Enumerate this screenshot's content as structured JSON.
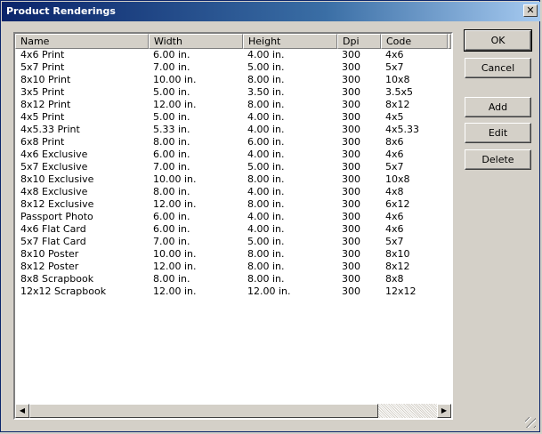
{
  "window": {
    "title": "Product Renderings",
    "close_glyph": "✕"
  },
  "table": {
    "columns": [
      "Name",
      "Width",
      "Height",
      "Dpi",
      "Code"
    ],
    "rows": [
      [
        "4x6 Print",
        "6.00 in.",
        "4.00 in.",
        "300",
        "4x6"
      ],
      [
        "5x7 Print",
        "7.00 in.",
        "5.00 in.",
        "300",
        "5x7"
      ],
      [
        "8x10 Print",
        "10.00 in.",
        "8.00 in.",
        "300",
        "10x8"
      ],
      [
        "3x5 Print",
        "5.00 in.",
        "3.50 in.",
        "300",
        "3.5x5"
      ],
      [
        "8x12 Print",
        "12.00 in.",
        "8.00 in.",
        "300",
        "8x12"
      ],
      [
        "4x5 Print",
        "5.00 in.",
        "4.00 in.",
        "300",
        "4x5"
      ],
      [
        "4x5.33 Print",
        "5.33 in.",
        "4.00 in.",
        "300",
        "4x5.33"
      ],
      [
        "6x8 Print",
        "8.00 in.",
        "6.00 in.",
        "300",
        "8x6"
      ],
      [
        "4x6 Exclusive",
        "6.00 in.",
        "4.00 in.",
        "300",
        "4x6"
      ],
      [
        "5x7 Exclusive",
        "7.00 in.",
        "5.00 in.",
        "300",
        "5x7"
      ],
      [
        "8x10 Exclusive",
        "10.00 in.",
        "8.00 in.",
        "300",
        "10x8"
      ],
      [
        "4x8 Exclusive",
        "8.00 in.",
        "4.00 in.",
        "300",
        "4x8"
      ],
      [
        "8x12 Exclusive",
        "12.00 in.",
        "8.00 in.",
        "300",
        "6x12"
      ],
      [
        "Passport Photo",
        "6.00 in.",
        "4.00 in.",
        "300",
        "4x6"
      ],
      [
        "4x6 Flat Card",
        "6.00 in.",
        "4.00 in.",
        "300",
        "4x6"
      ],
      [
        "5x7 Flat Card",
        "7.00 in.",
        "5.00 in.",
        "300",
        "5x7"
      ],
      [
        "8x10 Poster",
        "10.00 in.",
        "8.00 in.",
        "300",
        "8x10"
      ],
      [
        "8x12 Poster",
        "12.00 in.",
        "8.00 in.",
        "300",
        "8x12"
      ],
      [
        "8x8 Scrapbook",
        "8.00 in.",
        "8.00 in.",
        "300",
        "8x8"
      ],
      [
        "12x12 Scrapbook",
        "12.00 in.",
        "12.00 in.",
        "300",
        "12x12"
      ]
    ]
  },
  "scrollbar": {
    "left_arrow": "◀",
    "right_arrow": "▶"
  },
  "buttons": {
    "ok": "OK",
    "cancel": "Cancel",
    "add": "Add",
    "edit": "Edit",
    "delete": "Delete"
  },
  "colors": {
    "titlebar_start": "#0a246a",
    "titlebar_end": "#a6caf0",
    "face": "#d4d0c8"
  }
}
